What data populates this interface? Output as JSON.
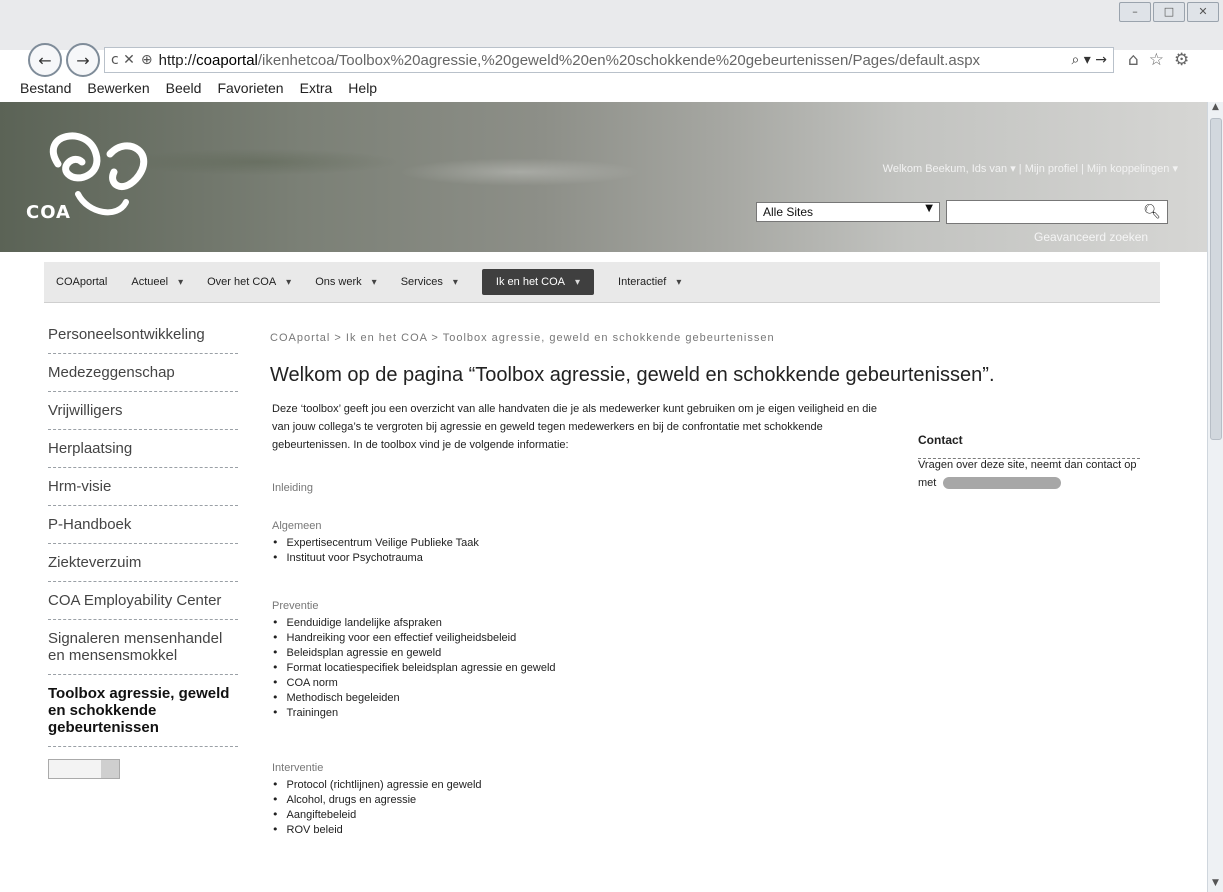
{
  "browser": {
    "url_scheme": "http://",
    "url_host": "coaportal",
    "url_path": "/ikenhetcoa/Toolbox%20agressie,%20geweld%20en%20schokkende%20gebeurtenissen/Pages/default.aspx",
    "address_prefix": "c ✕",
    "search_symbol": "⌕ ▾ →",
    "menu": [
      {
        "label": "Bestand"
      },
      {
        "label": "Bewerken"
      },
      {
        "label": "Beeld"
      },
      {
        "label": "Favorieten"
      },
      {
        "label": "Extra"
      },
      {
        "label": "Help"
      }
    ]
  },
  "header": {
    "logo_text": "COA",
    "welcome": "Welkom Beekum, Ids van ▾ | Mijn profiel | Mijn koppelingen ▾",
    "site_select": "Alle Sites",
    "search_placeholder": "",
    "advanced_search": "Geavanceerd zoeken"
  },
  "topnav": [
    {
      "label": "COAportal",
      "chevron": ""
    },
    {
      "label": "Actueel",
      "chevron": "▾"
    },
    {
      "label": "Over het COA",
      "chevron": "▾"
    },
    {
      "label": "Ons werk",
      "chevron": "▾"
    },
    {
      "label": "Services",
      "chevron": "▾"
    },
    {
      "label": "Ik en het COA",
      "chevron": "▾",
      "active": true
    },
    {
      "label": "Interactief",
      "chevron": "▾"
    }
  ],
  "leftnav": [
    {
      "label": "Personeelsontwikkeling"
    },
    {
      "label": "Medezeggenschap"
    },
    {
      "label": "Vrijwilligers"
    },
    {
      "label": "Herplaatsing"
    },
    {
      "label": "Hrm-visie"
    },
    {
      "label": "P-Handboek"
    },
    {
      "label": "Ziekteverzuim"
    },
    {
      "label": "COA Employability Center"
    },
    {
      "label": "Signaleren mensenhandel en mensensmokkel"
    },
    {
      "label": "Toolbox agressie, geweld en schokkende gebeurtenissen",
      "current": true
    }
  ],
  "content": {
    "breadcrumb": "COAportal > Ik en het COA > Toolbox agressie, geweld en schokkende gebeurtenissen",
    "title": "Welkom op de pagina “Toolbox agressie, geweld en schokkende gebeurtenissen”.",
    "intro": "Deze ‘toolbox’ geeft jou een overzicht van alle handvaten die je als medewerker kunt gebruiken om je eigen veiligheid en die van jouw collega’s te vergroten bij agressie en geweld tegen medewerkers en bij de confrontatie met schokkende gebeurtenissen. In de toolbox vind je de volgende informatie:",
    "sections": [
      {
        "label": "Inleiding",
        "items": []
      },
      {
        "label": "Algemeen",
        "items": [
          "Expertisecentrum Veilige Publieke Taak",
          "Instituut voor Psychotrauma"
        ]
      },
      {
        "label": "Preventie",
        "items": [
          "Eenduidige landelijke afspraken",
          "Handreiking voor een effectief veiligheidsbeleid",
          "Beleidsplan agressie en geweld",
          "Format locatiespecifiek beleidsplan agressie en geweld",
          "COA norm",
          "Methodisch begeleiden",
          "Trainingen"
        ]
      },
      {
        "label": "Interventie",
        "items": [
          "Protocol (richtlijnen) agressie en geweld",
          "Alcohol, drugs en agressie",
          "Aangiftebeleid",
          "ROV beleid"
        ]
      }
    ]
  },
  "contact": {
    "title": "Contact",
    "text": "Vragen over deze site, neemt dan contact op met"
  }
}
